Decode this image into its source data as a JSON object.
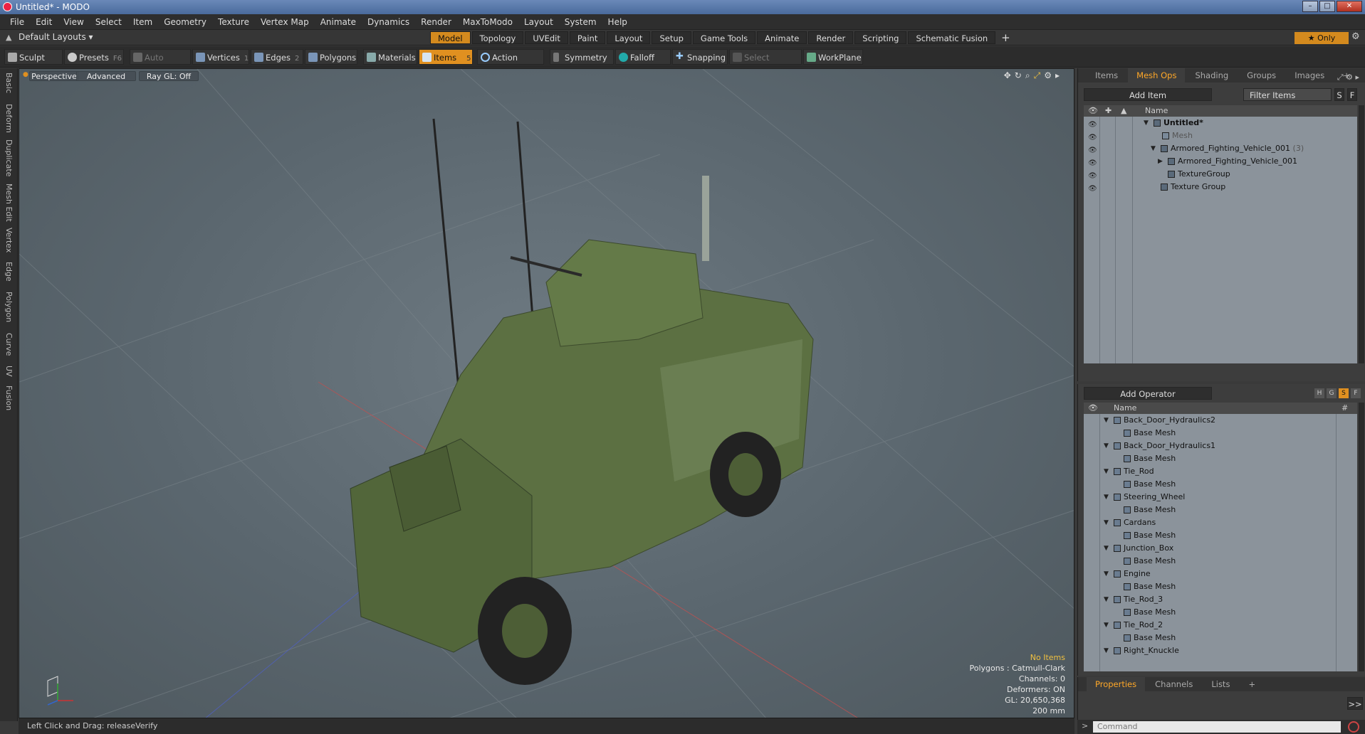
{
  "window": {
    "title": "Untitled* - MODO",
    "minimize": "–",
    "maximize": "□",
    "close": "✕"
  },
  "menu": [
    "File",
    "Edit",
    "View",
    "Select",
    "Item",
    "Geometry",
    "Texture",
    "Vertex Map",
    "Animate",
    "Dynamics",
    "Render",
    "MaxToModo",
    "Layout",
    "System",
    "Help"
  ],
  "layoutbar": {
    "layout_dropdown": "Default Layouts ▾",
    "tabs": [
      "Model",
      "Topology",
      "UVEdit",
      "Paint",
      "Layout",
      "Setup",
      "Game Tools",
      "Animate",
      "Render",
      "Scripting",
      "Schematic Fusion"
    ],
    "active_tab": "Model",
    "plus": "+",
    "only_button": "★ Only",
    "gear": "⚙"
  },
  "toolbar": {
    "sculpt": "Sculpt",
    "presets": "Presets",
    "presets_key": "F6",
    "auto_select": "Auto Select",
    "vertices": "Vertices",
    "vertices_key": "1",
    "edges": "Edges",
    "edges_key": "2",
    "polygons": "Polygons",
    "materials": "Materials",
    "items": "Items",
    "items_key": "5",
    "action_center": "Action Center",
    "symmetry": "Symmetry",
    "falloff": "Falloff",
    "snapping": "Snapping",
    "select_through": "Select Through",
    "workplane": "WorkPlane"
  },
  "leftstrip": [
    "Basic",
    "Deform",
    "Duplicate",
    "Mesh Edit",
    "Vertex",
    "Edge",
    "Polygon",
    "Curve",
    "UV",
    "Fusion"
  ],
  "viewport": {
    "perspective": "Perspective",
    "advanced": "Advanced",
    "raygl": "Ray GL: Off",
    "info": {
      "items": "No Items",
      "polygons": "Polygons : Catmull-Clark",
      "channels": "Channels: 0",
      "deformers": "Deformers: ON",
      "gl": "GL: 20,650,368",
      "unit": "200 mm"
    }
  },
  "status": {
    "text": "Left Click and Drag:   releaseVerify"
  },
  "items_panel": {
    "tabs": [
      "Items",
      "Mesh Ops",
      "Shading",
      "Groups",
      "Images",
      "+"
    ],
    "active_tab": "Mesh Ops",
    "add_item": "Add Item",
    "filter": "Filter Items",
    "s_btn": "S",
    "f_btn": "F",
    "col_name": "Name",
    "tree": [
      {
        "label": "Untitled*",
        "indent": 1,
        "bold": true,
        "gray": false
      },
      {
        "label": "Mesh",
        "indent": 2,
        "bold": false,
        "gray": true
      },
      {
        "label": "Armored_Fighting_Vehicle_001",
        "count": "(3)",
        "indent": 1,
        "bold": false,
        "gray": false
      },
      {
        "label": "Armored_Fighting_Vehicle_001",
        "indent": 2,
        "bold": false,
        "gray": false
      },
      {
        "label": "TextureGroup",
        "indent": 3,
        "bold": false,
        "gray": false
      },
      {
        "label": "Texture Group",
        "indent": 1,
        "bold": false,
        "gray": false
      }
    ]
  },
  "meshops_panel": {
    "add_operator": "Add Operator",
    "col_name": "Name",
    "col_hash": "#",
    "h_btn": "H",
    "g_btn": "G",
    "s_btn": "S",
    "f_btn": "F",
    "items": [
      "Back_Door_Hydraulics2",
      "Back_Door_Hydraulics1",
      "Tie_Rod",
      "Steering_Wheel",
      "Cardans",
      "Junction_Box",
      "Engine",
      "Tie_Rod_3",
      "Tie_Rod_2",
      "Right_Knuckle"
    ],
    "child_label": "Base Mesh"
  },
  "properties_panel": {
    "tabs": [
      "Properties",
      "Channels",
      "Lists",
      "+"
    ],
    "active_tab": "Properties",
    "expand": ">>"
  },
  "command": {
    "placeholder": "Command",
    "prompt": ">"
  }
}
